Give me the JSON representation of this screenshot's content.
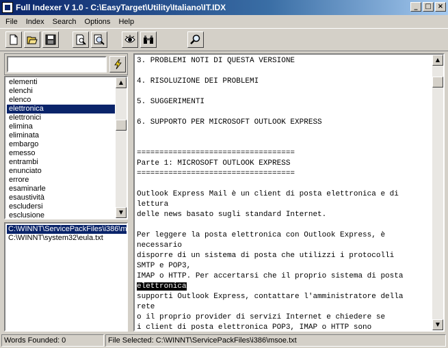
{
  "window": {
    "title": "Full Indexer V 1.0 - C:\\EasyTarget\\Utility\\Italiano\\IT.IDX",
    "controls": [
      "_",
      "□",
      "×"
    ]
  },
  "menu": [
    "File",
    "Index",
    "Search",
    "Options",
    "Help"
  ],
  "toolbar": {
    "buttons": [
      "new-icon",
      "open-icon",
      "save-icon",
      "print-preview-icon",
      "zoom-page-icon",
      "eye-icon",
      "binoculars-icon",
      "magnifier-icon"
    ]
  },
  "search": {
    "value": "",
    "placeholder": ""
  },
  "words": {
    "items": [
      "elementi",
      "elenchi",
      "elenco",
      "elettronica",
      "elettronici",
      "elimina",
      "eliminata",
      "embargo",
      "emesso",
      "entrambi",
      "enunciato",
      "errore",
      "esaminarle",
      "esaustività",
      "escludersi",
      "esclusione"
    ],
    "selected": "elettronica"
  },
  "files": {
    "items": [
      "C:\\WINNT\\ServicePackFiles\\i386\\msoe.txt",
      "C:\\WINNT\\system32\\eula.txt"
    ],
    "selected": "C:\\WINNT\\ServicePackFiles\\i386\\msoe.txt"
  },
  "document": {
    "lines": [
      "3. PROBLEMI NOTI DI QUESTA VERSIONE",
      "",
      "4. RISOLUZIONE DEI PROBLEMI",
      "",
      "5. SUGGERIMENTI",
      "",
      "6. SUPPORTO PER MICROSOFT OUTLOOK EXPRESS",
      "",
      "",
      "===================================",
      "Parte 1: MICROSOFT OUTLOOK EXPRESS",
      "===================================",
      "",
      "Outlook Express Mail è un client di posta elettronica e di",
      "lettura",
      "delle news basato sugli standard Internet.",
      "",
      "Per leggere la posta elettronica con Outlook Express, è",
      "necessario",
      "disporre di un sistema di posta che utilizzi i protocolli",
      "SMTP e POP3,",
      "IMAP o HTTP. Per accertarsi che il proprio sistema di posta",
      "elettronica",
      "supporti Outlook Express, contattare l'amministratore della",
      "rete",
      "o il proprio provider di servizi Internet e chiedere se",
      "i client di posta elettronica POP3, IMAP o HTTP sono"
    ],
    "highlight_line": 22
  },
  "status": {
    "words_founded": "Words Founded: 0",
    "file_selected": "File Selected: C:\\WINNT\\ServicePackFiles\\i386\\msoe.txt"
  }
}
